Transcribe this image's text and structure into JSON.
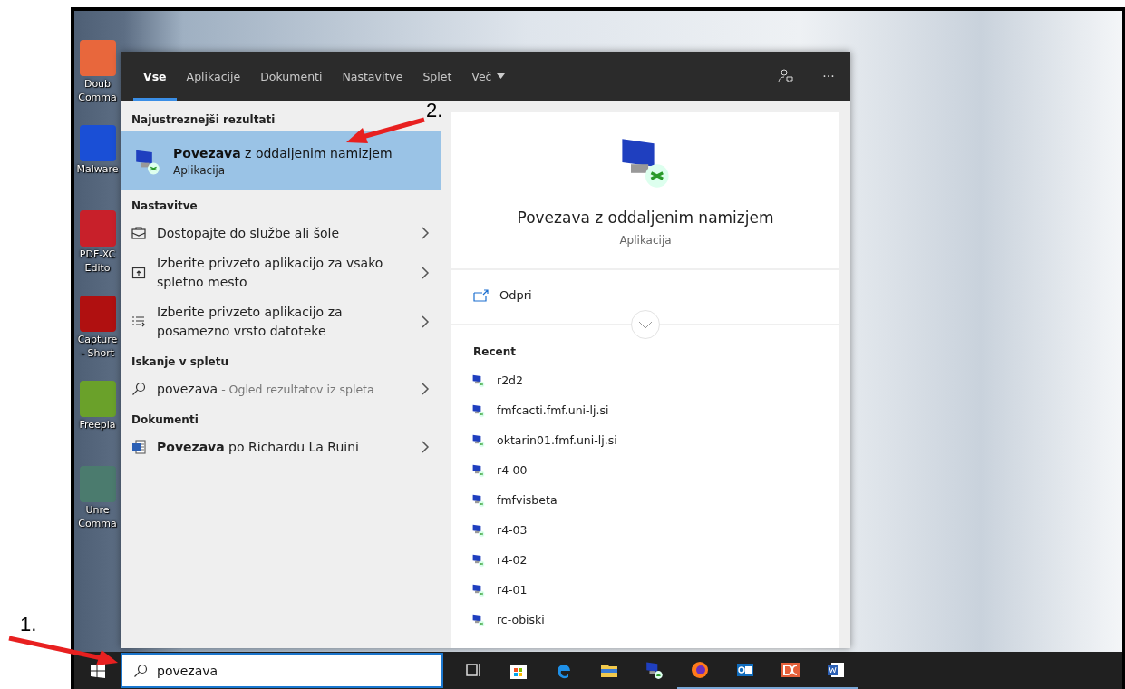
{
  "desktop_icons": [
    {
      "kind": "dc",
      "lines": [
        "Doub",
        "Comma"
      ]
    },
    {
      "kind": "malware",
      "lines": [
        "Malware"
      ]
    },
    {
      "kind": "pdf",
      "lines": [
        "PDF-XC",
        "Edito"
      ]
    },
    {
      "kind": "capture",
      "lines": [
        "Capture",
        "- Short"
      ]
    },
    {
      "kind": "freeplane",
      "lines": [
        "Freepla"
      ]
    },
    {
      "kind": "unreal",
      "lines": [
        "Unre",
        "Comma"
      ]
    }
  ],
  "search_panel": {
    "tabs": [
      {
        "label": "Vse",
        "selected": true,
        "kind": "tab"
      },
      {
        "label": "Aplikacije",
        "selected": false,
        "kind": "tab"
      },
      {
        "label": "Dokumenti",
        "selected": false,
        "kind": "tab"
      },
      {
        "label": "Nastavitve",
        "selected": false,
        "kind": "tab"
      },
      {
        "label": "Splet",
        "selected": false,
        "kind": "tab"
      },
      {
        "label": "Več",
        "selected": false,
        "kind": "dropdown"
      }
    ],
    "more": "···",
    "best_match": {
      "heading": "Najustreznejši rezultati",
      "title": "**Povezava** z oddaljenim namizjem",
      "subtitle": "Aplikacija",
      "selected": true
    },
    "sections": [
      {
        "heading": "Nastavitve",
        "items": [
          {
            "kind": "briefcase",
            "text": "Dostopajte do službe ali šole"
          },
          {
            "kind": "window",
            "text": "Izberite privzeto aplikacijo za vsako spletno mesto"
          },
          {
            "kind": "list",
            "text": "Izberite privzeto aplikacijo za posamezno vrsto datoteke"
          }
        ]
      },
      {
        "heading": "Iskanje v spletu",
        "items": [
          {
            "kind": "search",
            "text": "povezava",
            "hint": "- Ogled rezultatov iz spleta"
          }
        ]
      },
      {
        "heading": "Dokumenti",
        "items": [
          {
            "kind": "document",
            "text": "**Povezava** po Richardu La Ruini"
          }
        ]
      }
    ],
    "preview": {
      "title": "Povezava z oddaljenim namizjem",
      "subtitle": "Aplikacija",
      "action": "Odpri",
      "recent_heading": "Recent",
      "recent": [
        "r2d2",
        "fmfcacti.fmf.uni-lj.si",
        "oktarin01.fmf.uni-lj.si",
        "r4-00",
        "fmfvisbeta",
        "r4-03",
        "r4-02",
        "r4-01",
        "rc-obiski"
      ]
    }
  },
  "taskbar": {
    "search_value": "povezava",
    "apps": [
      {
        "kind": "taskview",
        "running": false
      },
      {
        "kind": "store",
        "running": false
      },
      {
        "kind": "edge",
        "running": false
      },
      {
        "kind": "folder",
        "running": false
      },
      {
        "kind": "remote",
        "running": false
      },
      {
        "kind": "firefox",
        "running": true
      },
      {
        "kind": "mail",
        "running": true
      },
      {
        "kind": "dc",
        "running": true
      },
      {
        "kind": "word",
        "running": true
      }
    ]
  },
  "annotations": [
    {
      "label": "1."
    },
    {
      "label": "2."
    }
  ]
}
